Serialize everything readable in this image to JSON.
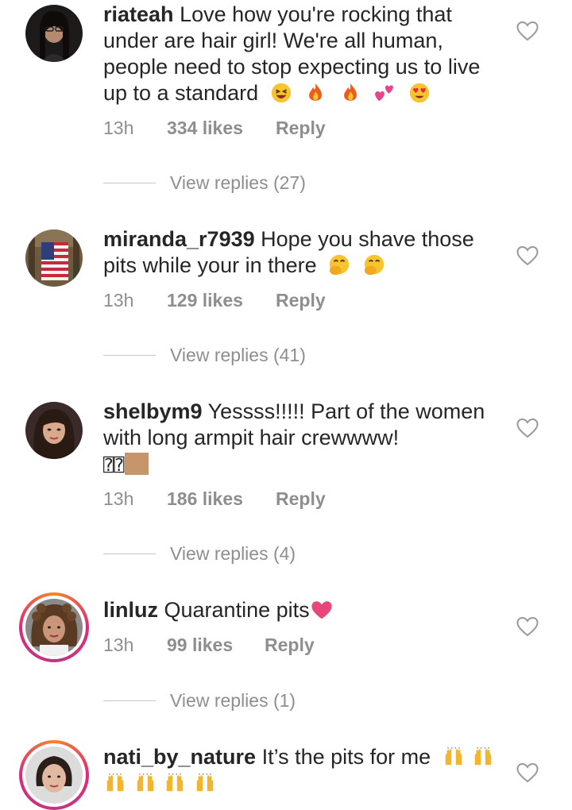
{
  "comments": [
    {
      "username": "riateah",
      "text": "Love how you're rocking that under are hair girl! We're all human, people need to stop expecting us to live up to a standard",
      "time": "13h",
      "likes": "334 likes",
      "reply": "Reply",
      "view_replies": "View replies (27)"
    },
    {
      "username": "miranda_r7939",
      "text": "Hope you shave those pits while your in there",
      "time": "13h",
      "likes": "129 likes",
      "reply": "Reply",
      "view_replies": "View replies (41)"
    },
    {
      "username": "shelbym9",
      "text": "Yessss!!!!! Part of the women with long armpit hair crewwww!",
      "extra_chars": "⍰⍰",
      "time": "13h",
      "likes": "186 likes",
      "reply": "Reply",
      "view_replies": "View replies (4)"
    },
    {
      "username": "linluz",
      "text": "Quarantine pits",
      "time": "13h",
      "likes": "99 likes",
      "reply": "Reply",
      "view_replies": "View replies (1)"
    },
    {
      "username": "nati_by_nature",
      "text": "It’s the pits for me"
    }
  ],
  "icons": {
    "like": "heart-outline-icon"
  },
  "colors": {
    "username": "#262626",
    "meta": "#8e8e8e",
    "story_ring_start": "#f58529",
    "story_ring_end": "#dd2a7b"
  }
}
